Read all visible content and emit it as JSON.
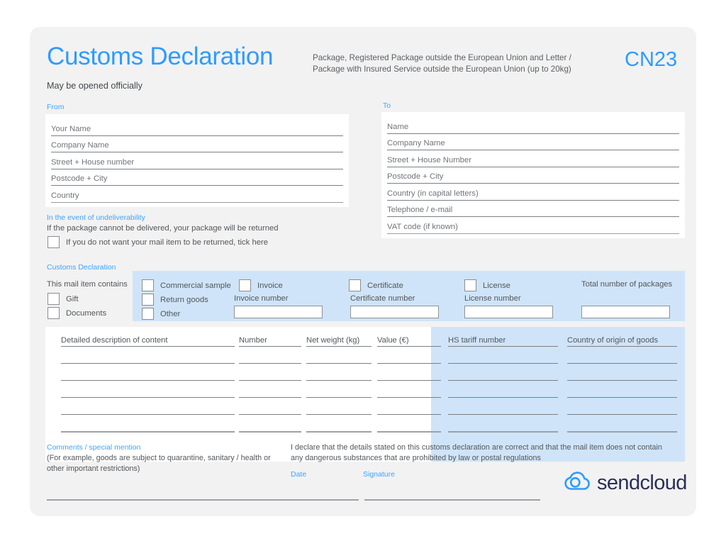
{
  "header": {
    "title": "Customs Declaration",
    "subtitle_line1": "Package, Registered Package outside the European Union and Letter /",
    "subtitle_line2": "Package with Insured Service outside the European Union (up to 20kg)",
    "form_code": "CN23",
    "may_be_opened": "May be opened officially"
  },
  "from": {
    "label": "From",
    "fields": [
      {
        "placeholder": "Your Name"
      },
      {
        "placeholder": "Company Name"
      },
      {
        "placeholder": "Street + House number"
      },
      {
        "placeholder": "Postcode + City"
      },
      {
        "placeholder": "Country"
      }
    ]
  },
  "to": {
    "label": "To",
    "fields": [
      {
        "placeholder": "Name"
      },
      {
        "placeholder": "Company Name"
      },
      {
        "placeholder": "Street + House Number"
      },
      {
        "placeholder": "Postcode + City"
      },
      {
        "placeholder": "Country (in capital letters)"
      },
      {
        "placeholder": "Telephone / e-mail"
      },
      {
        "placeholder": "VAT code (if known)"
      }
    ]
  },
  "undeliverability": {
    "label": "In the event of undeliverability",
    "description": "If the package cannot be delivered, your package will be returned",
    "checkbox_label": "If you do not want your mail item to be returned, tick here",
    "checked": false
  },
  "customs_declaration": {
    "label": "Customs Declaration",
    "contains_title": "This mail item contains",
    "contains_options": [
      {
        "label": "Gift",
        "checked": false
      },
      {
        "label": "Documents",
        "checked": false
      },
      {
        "label": "Commercial sample",
        "checked": false
      },
      {
        "label": "Return goods",
        "checked": false
      },
      {
        "label": "Other",
        "checked": false
      },
      {
        "label": "Invoice",
        "checked": false
      },
      {
        "label": "Certificate",
        "checked": false
      },
      {
        "label": "License",
        "checked": false
      }
    ],
    "invoice_number_label": "Invoice number",
    "invoice_number_value": "",
    "certificate_number_label": "Certificate number",
    "certificate_number_value": "",
    "license_number_label": "License number",
    "license_number_value": "",
    "total_packages_label": "Total number of packages",
    "total_packages_value": ""
  },
  "goods_table": {
    "columns": [
      "Detailed description of content",
      "Number",
      "Net weight (kg)",
      "Value (€)",
      "HS tariff number",
      "Country of origin of goods"
    ],
    "row_count": 5
  },
  "comments": {
    "label": "Comments / special mention",
    "hint": "(For example, goods are subject to quarantine, sanitary / health or other important restrictions)",
    "value": ""
  },
  "declaration": {
    "text": "I declare that the details stated on this customs declaration are correct and that the mail item does not contain any dangerous substances that are prohibited by law or postal regulations",
    "date_label": "Date",
    "date_value": "",
    "signature_label": "Signature",
    "signature_value": ""
  },
  "branding": {
    "logo_text": "sendcloud",
    "logo_icon": "cloud-icon"
  },
  "colors": {
    "accent_blue": "#2e9bff",
    "label_blue": "#3fa3ff",
    "panel_blue": "#cfe4f8",
    "card_bg": "#f2f2f2",
    "logo_navy": "#2b2f56"
  }
}
